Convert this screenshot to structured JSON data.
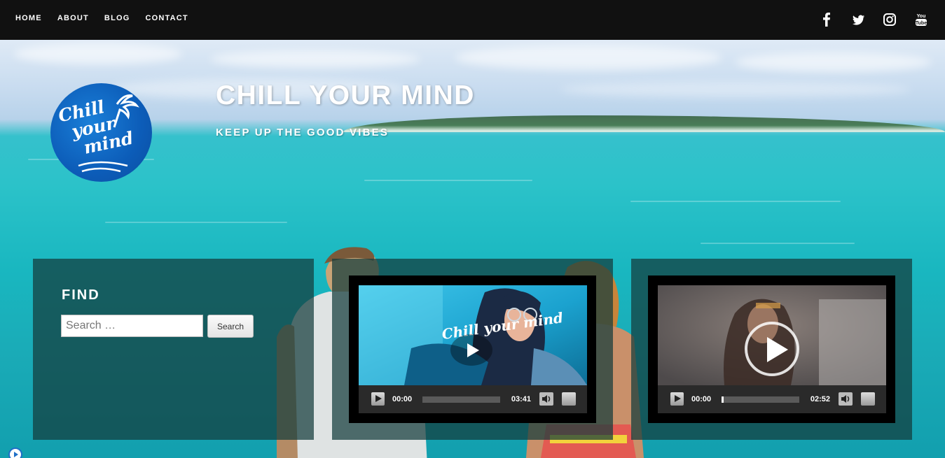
{
  "nav": {
    "items": [
      {
        "label": "HOME"
      },
      {
        "label": "ABOUT"
      },
      {
        "label": "BLOG"
      },
      {
        "label": "CONTACT"
      }
    ]
  },
  "social": {
    "icons": [
      "facebook-icon",
      "twitter-icon",
      "instagram-icon",
      "youtube-icon"
    ],
    "youtube_text": "You Tube"
  },
  "logo": {
    "text_line1": "Chill",
    "text_line2": "your",
    "text_line3": "mind"
  },
  "site": {
    "title": "CHILL YOUR MIND",
    "tagline": "KEEP UP THE GOOD VIBES"
  },
  "find_widget": {
    "title": "FIND",
    "search_placeholder": "Search …",
    "search_button": "Search"
  },
  "videos": [
    {
      "current_time": "00:00",
      "total_time": "03:41",
      "progress": 0.0,
      "overlay_text": "Chill your mind"
    },
    {
      "current_time": "00:00",
      "total_time": "02:52",
      "progress": 0.01
    }
  ],
  "colors": {
    "topbar": "#111111",
    "panel": "#143c3c",
    "accent_blue": "#0c5cb8"
  }
}
